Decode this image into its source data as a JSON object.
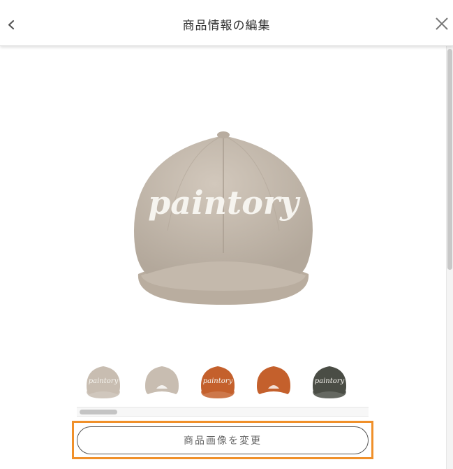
{
  "header": {
    "title": "商品情報の編集",
    "back_icon": "chevron-left-icon",
    "close_icon": "close-icon"
  },
  "product": {
    "logo_text": "paintory",
    "main_color": "#c8bdb1",
    "thumbnails": [
      {
        "label": "beige-front",
        "color": "#c8bdb1",
        "logo": true
      },
      {
        "label": "beige-back",
        "color": "#c8bdb1",
        "logo": false
      },
      {
        "label": "orange-front",
        "color": "#c4602c",
        "logo": true
      },
      {
        "label": "orange-back",
        "color": "#c4602c",
        "logo": false
      },
      {
        "label": "dark-front",
        "color": "#4a4d45",
        "logo": true
      }
    ]
  },
  "actions": {
    "change_image_label": "商品画像を変更"
  },
  "colors": {
    "highlight": "#f0902a"
  }
}
